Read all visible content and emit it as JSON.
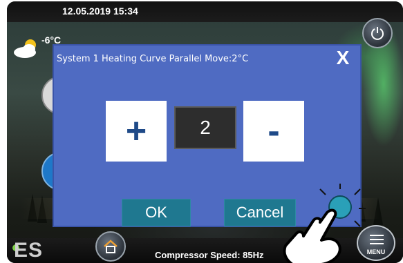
{
  "status_bar": {
    "datetime": "12.05.2019  15:34"
  },
  "weather": {
    "temperature": "-6°C",
    "icon": "partly-cloudy-icon"
  },
  "dialog": {
    "title": "System 1 Heating Curve Parallel Move:2°C",
    "close_label": "X",
    "plus_label": "+",
    "minus_label": "-",
    "value": "2",
    "ok_label": "OK",
    "cancel_label": "Cancel"
  },
  "footer": {
    "logo": "ES",
    "compressor_speed": "Compressor Speed: 85Hz",
    "menu_label": "MENU"
  },
  "colors": {
    "dialog_background": "#4f6bc2",
    "button_teal": "#1f7890",
    "value_box": "#2d2d2d"
  }
}
